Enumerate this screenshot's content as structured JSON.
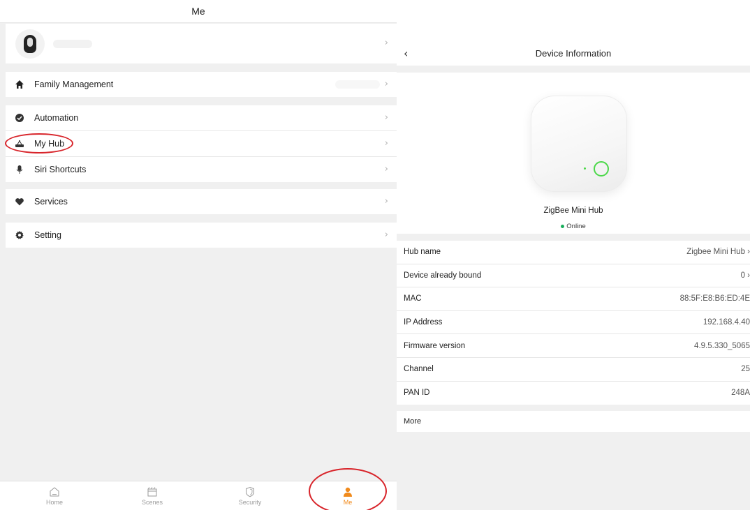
{
  "left": {
    "header_title": "Me",
    "menu": {
      "family": "Family Management",
      "automation": "Automation",
      "my_hub": "My Hub",
      "siri": "Siri Shortcuts",
      "services": "Services",
      "setting": "Setting"
    },
    "tabs": [
      {
        "label": "Home",
        "icon": "home-icon"
      },
      {
        "label": "Scenes",
        "icon": "scenes-icon"
      },
      {
        "label": "Security",
        "icon": "shield-icon"
      },
      {
        "label": "Me",
        "icon": "person-icon"
      }
    ],
    "active_tab": "Me",
    "accent_color": "#f08a1c",
    "annotation_color": "#d8242a",
    "chevron": "›"
  },
  "right": {
    "nav_title": "Device Information",
    "back_glyph": "‹",
    "hub_title": "ZigBee Mini Hub",
    "status": "Online",
    "status_color": "#1aae5c",
    "rows": [
      {
        "key": "Hub name",
        "value": "Zigbee Mini Hub  ›"
      },
      {
        "key": "Device already bound",
        "value": "0  ›"
      },
      {
        "key": "MAC",
        "value": "88:5F:E8:B6:ED:4E"
      },
      {
        "key": "IP Address",
        "value": "192.168.4.40"
      },
      {
        "key": "Firmware version",
        "value": "4.9.5.330_5065"
      },
      {
        "key": "Channel",
        "value": "25"
      },
      {
        "key": "PAN ID",
        "value": "248A"
      }
    ],
    "more_label": "More"
  }
}
